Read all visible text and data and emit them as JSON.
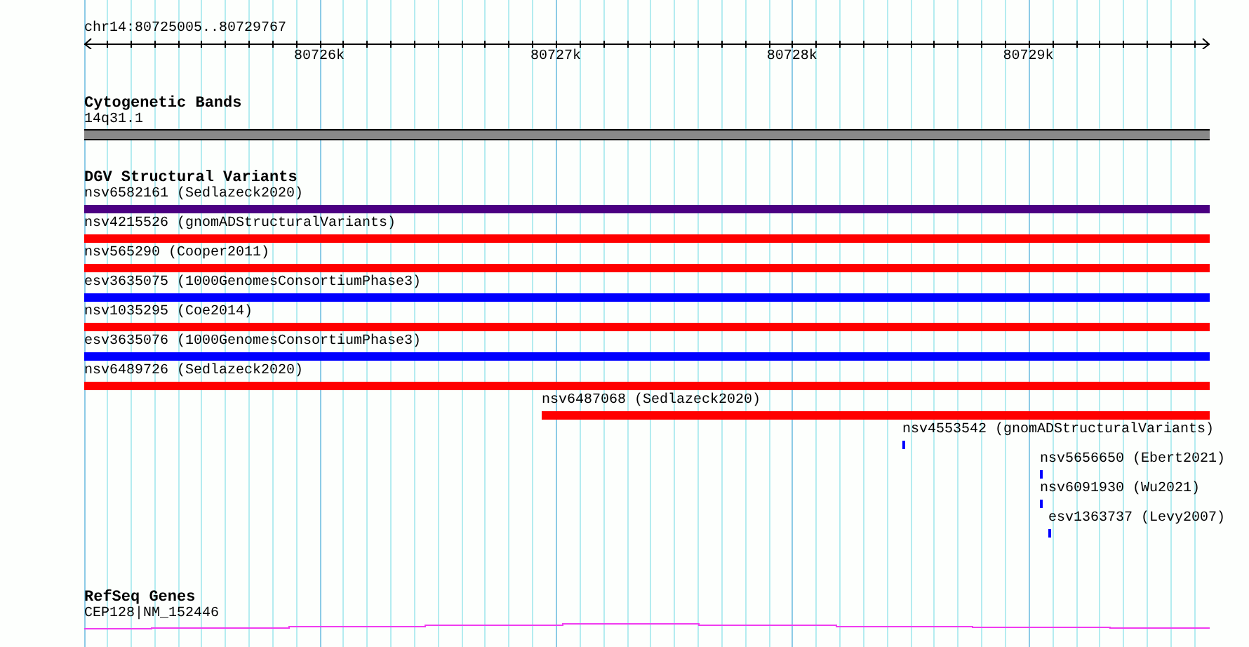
{
  "ruler": {
    "position": "chr14:80725005..80729767",
    "ticks": [
      "80726k",
      "80727k",
      "80728k",
      "80729k"
    ]
  },
  "cytogenetic_bands": {
    "title": "Cytogenetic Bands",
    "band": {
      "label": "14q31.1"
    }
  },
  "dgv_structural_variants": {
    "title": "DGV Structural Variants",
    "variants": [
      {
        "label": "nsv6582161 (Sedlazeck2020)",
        "color": "#4b0082"
      },
      {
        "label": "nsv4215526 (gnomADStructuralVariants)",
        "color": "#ff0000"
      },
      {
        "label": "nsv565290 (Cooper2011)",
        "color": "#ff0000"
      },
      {
        "label": "esv3635075 (1000GenomesConsortiumPhase3)",
        "color": "#0000ff"
      },
      {
        "label": "nsv1035295 (Coe2014)",
        "color": "#ff0000"
      },
      {
        "label": "esv3635076 (1000GenomesConsortiumPhase3)",
        "color": "#0000ff"
      },
      {
        "label": "nsv6489726 (Sedlazeck2020)",
        "color": "#ff0000"
      },
      {
        "label": "nsv6487068 (Sedlazeck2020)",
        "color": "#ff0000"
      },
      {
        "label": "nsv4553542 (gnomADStructuralVariants)",
        "color": "#0000ff"
      },
      {
        "label": "nsv5656650 (Ebert2021)",
        "color": "#0000ff"
      },
      {
        "label": "nsv6091930 (Wu2021)",
        "color": "#0000ff"
      },
      {
        "label": "esv1363737 (Levy2007)",
        "color": "#0000ff"
      }
    ]
  },
  "refseq_genes": {
    "title": "RefSeq Genes",
    "genes": [
      {
        "label": "CEP128|NM_152446"
      }
    ]
  }
}
